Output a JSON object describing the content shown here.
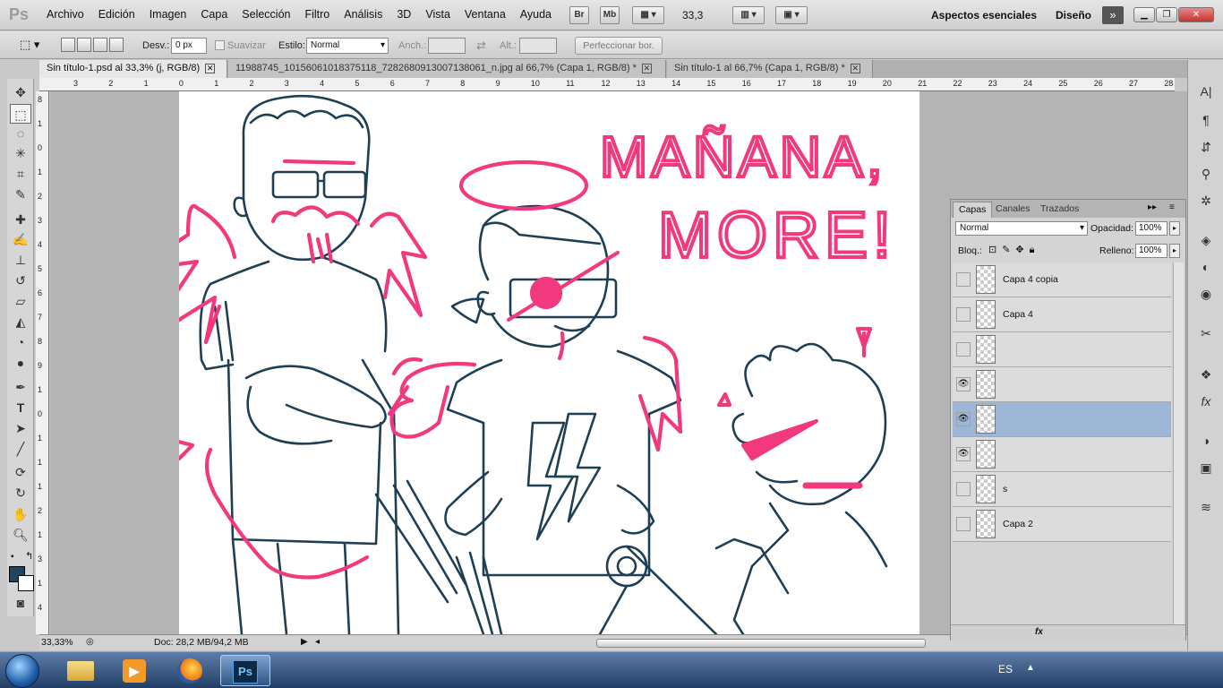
{
  "app": {
    "logo": "Ps"
  },
  "menu": [
    "Archivo",
    "Edición",
    "Imagen",
    "Capa",
    "Selección",
    "Filtro",
    "Análisis",
    "3D",
    "Vista",
    "Ventana",
    "Ayuda"
  ],
  "menubar": {
    "bridge": "Br",
    "mini_bridge": "Mb",
    "zoom": "33,3",
    "workspace": "Aspectos esenciales",
    "design": "Diseño"
  },
  "options": {
    "feather_label": "Desv.:",
    "feather_value": "0 px",
    "antialias_label": "Suavizar",
    "style_label": "Estilo:",
    "style_value": "Normal",
    "width_label": "Anch.:",
    "height_label": "Alt.:",
    "refine_button": "Perfeccionar bor."
  },
  "tabs": [
    {
      "label": "Sin título-1.psd al 33,3% (j, RGB/8)"
    },
    {
      "label": "11988745_10156061018375118_7282680913007138061_n.jpg al 66,7% (Capa 1, RGB/8) *"
    },
    {
      "label": "Sin título-1 al 66,7% (Capa 1, RGB/8) *"
    }
  ],
  "ruler": {
    "top": [
      "3",
      "2",
      "1",
      "0",
      "1",
      "2",
      "3",
      "4",
      "5",
      "6",
      "7",
      "8",
      "9",
      "10",
      "11",
      "12",
      "13",
      "14",
      "15",
      "16",
      "17",
      "18",
      "19",
      "20",
      "21",
      "22",
      "23",
      "24",
      "25",
      "26",
      "27",
      "28",
      "2"
    ],
    "left": [
      "8",
      "1",
      "0",
      "1",
      "2",
      "3",
      "4",
      "5",
      "6",
      "7",
      "8",
      "9",
      "1",
      "0",
      "1",
      "1",
      "1",
      "2",
      "1",
      "3",
      "1",
      "4"
    ]
  },
  "artwork": {
    "speech_line1": "MAÑANA,",
    "speech_line2": "MORE!"
  },
  "status": {
    "zoom": "33,33%",
    "doc": "Doc: 28,2 MB/94,2 MB"
  },
  "layers_panel": {
    "tabs": [
      "Capas",
      "Canales",
      "Trazados"
    ],
    "blend_mode": "Normal",
    "opacity_label": "Opacidad:",
    "opacity_value": "100%",
    "lock_label": "Bloq.:",
    "fill_label": "Relleno:",
    "fill_value": "100%",
    "layers": [
      {
        "name": "Capa 4 copia",
        "visible": false
      },
      {
        "name": "Capa 4",
        "visible": false
      },
      {
        "name": "",
        "visible": false
      },
      {
        "name": "",
        "visible": true
      },
      {
        "name": "",
        "visible": true
      },
      {
        "name": "",
        "visible": true
      },
      {
        "name": "s",
        "visible": false
      },
      {
        "name": "Capa 2",
        "visible": false
      }
    ]
  },
  "taskbar": {
    "language": "ES",
    "ps_label": "Ps"
  },
  "colors": {
    "foreground": "#1d4564",
    "background": "#ffffff",
    "ink": "#1f3f55",
    "accent_pink": "#f2397e"
  }
}
